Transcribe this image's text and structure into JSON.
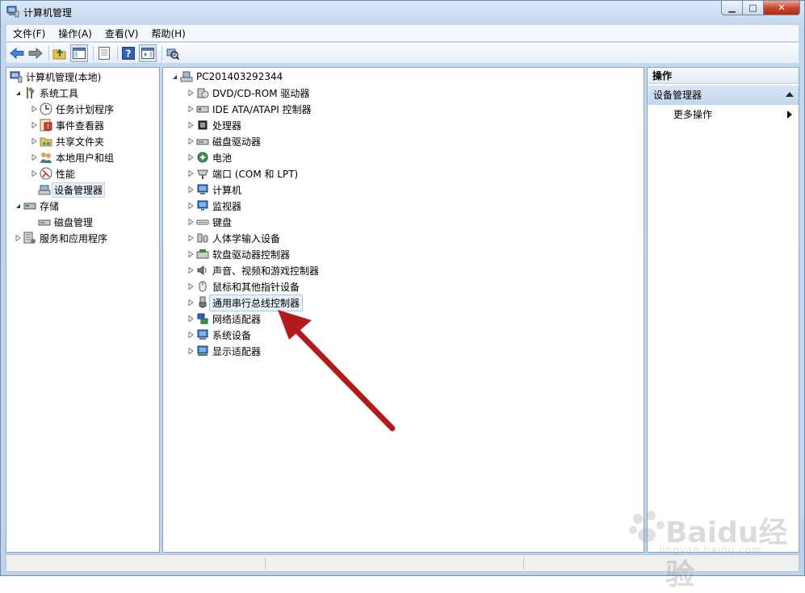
{
  "window": {
    "title": "计算机管理",
    "controls": {
      "minimize": "▁",
      "maximize": "□",
      "close": "✕"
    }
  },
  "menubar": {
    "items": [
      {
        "label": "文件(F)"
      },
      {
        "label": "操作(A)"
      },
      {
        "label": "查看(V)"
      },
      {
        "label": "帮助(H)"
      }
    ]
  },
  "toolbar": {
    "icons": [
      "back-icon",
      "forward-icon",
      "up-folder-icon",
      "show-hide-tree-icon",
      "export-list-icon",
      "help-icon",
      "show-action-pane-icon",
      "scan-hardware-icon"
    ]
  },
  "left_tree": {
    "root": "计算机管理(本地)",
    "system_tools": "系统工具",
    "task_scheduler": "任务计划程序",
    "event_viewer": "事件查看器",
    "shared_folders": "共享文件夹",
    "local_users": "本地用户和组",
    "performance": "性能",
    "device_manager": "设备管理器",
    "storage": "存储",
    "disk_management": "磁盘管理",
    "services_apps": "服务和应用程序"
  },
  "device_tree": {
    "computer": "PC201403292344",
    "categories": [
      {
        "label": "DVD/CD-ROM 驱动器",
        "icon": "dvd-icon"
      },
      {
        "label": "IDE ATA/ATAPI 控制器",
        "icon": "ide-controller-icon"
      },
      {
        "label": "处理器",
        "icon": "processor-icon"
      },
      {
        "label": "磁盘驱动器",
        "icon": "disk-drive-icon"
      },
      {
        "label": "电池",
        "icon": "battery-icon"
      },
      {
        "label": "端口 (COM 和 LPT)",
        "icon": "port-icon"
      },
      {
        "label": "计算机",
        "icon": "computer-icon"
      },
      {
        "label": "监视器",
        "icon": "monitor-icon"
      },
      {
        "label": "键盘",
        "icon": "keyboard-icon"
      },
      {
        "label": "人体学输入设备",
        "icon": "hid-icon"
      },
      {
        "label": "软盘驱动器控制器",
        "icon": "floppy-controller-icon"
      },
      {
        "label": "声音、视频和游戏控制器",
        "icon": "sound-icon"
      },
      {
        "label": "鼠标和其他指针设备",
        "icon": "mouse-icon"
      },
      {
        "label": "通用串行总线控制器",
        "icon": "usb-icon"
      },
      {
        "label": "网络适配器",
        "icon": "network-adapter-icon"
      },
      {
        "label": "系统设备",
        "icon": "system-device-icon"
      },
      {
        "label": "显示适配器",
        "icon": "display-adapter-icon"
      }
    ]
  },
  "actions_pane": {
    "header": "操作",
    "section": "设备管理器",
    "more": "更多操作"
  },
  "watermark": {
    "text": "Baidu经验",
    "sub": "jingyan.baidu.com"
  },
  "colors": {
    "annotation_arrow": "#b31b1b",
    "selection": "#e5eef9"
  }
}
